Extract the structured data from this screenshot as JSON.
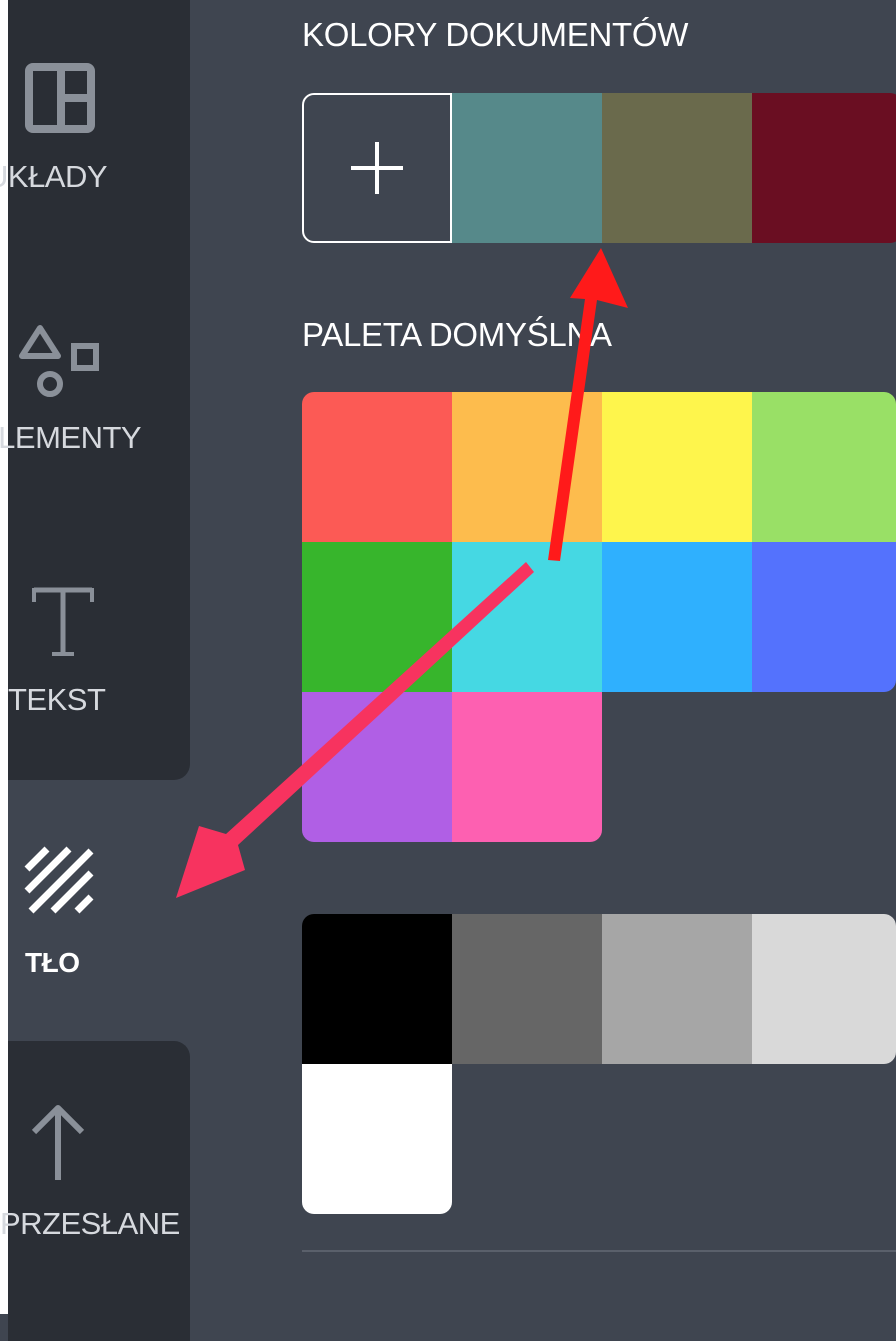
{
  "sidebar": {
    "items": [
      {
        "label": "UKŁADY",
        "icon": "layout-icon"
      },
      {
        "label": "ELEMENTY",
        "icon": "shapes-icon"
      },
      {
        "label": "TEKST",
        "icon": "text-icon"
      },
      {
        "label": "TŁO",
        "icon": "background-stripes-icon",
        "active": true
      },
      {
        "label": "PRZESŁANE",
        "icon": "upload-arrow-icon"
      }
    ]
  },
  "document_colors": {
    "title": "KOLORY DOKUMENTÓW",
    "add_button_icon": "plus-icon",
    "colors": [
      "#56898a",
      "#6a6a4c",
      "#6a0e22"
    ]
  },
  "default_palette": {
    "title": "PALETA DOMYŚLNA",
    "colors": [
      "#fc5a55",
      "#fdbc4d",
      "#fef54c",
      "#99e066",
      "#37b52c",
      "#45d8e3",
      "#2fb0fe",
      "#5472fd",
      "#b05fe5",
      "#fd60b1"
    ]
  },
  "grayscale_palette": {
    "colors": [
      "#000000",
      "#666666",
      "#a6a6a6",
      "#d9d9d9",
      "#ffffff"
    ]
  },
  "annotations": {
    "arrow_color_up": "#ff1a1a",
    "arrow_color_left": "#f7335f"
  }
}
